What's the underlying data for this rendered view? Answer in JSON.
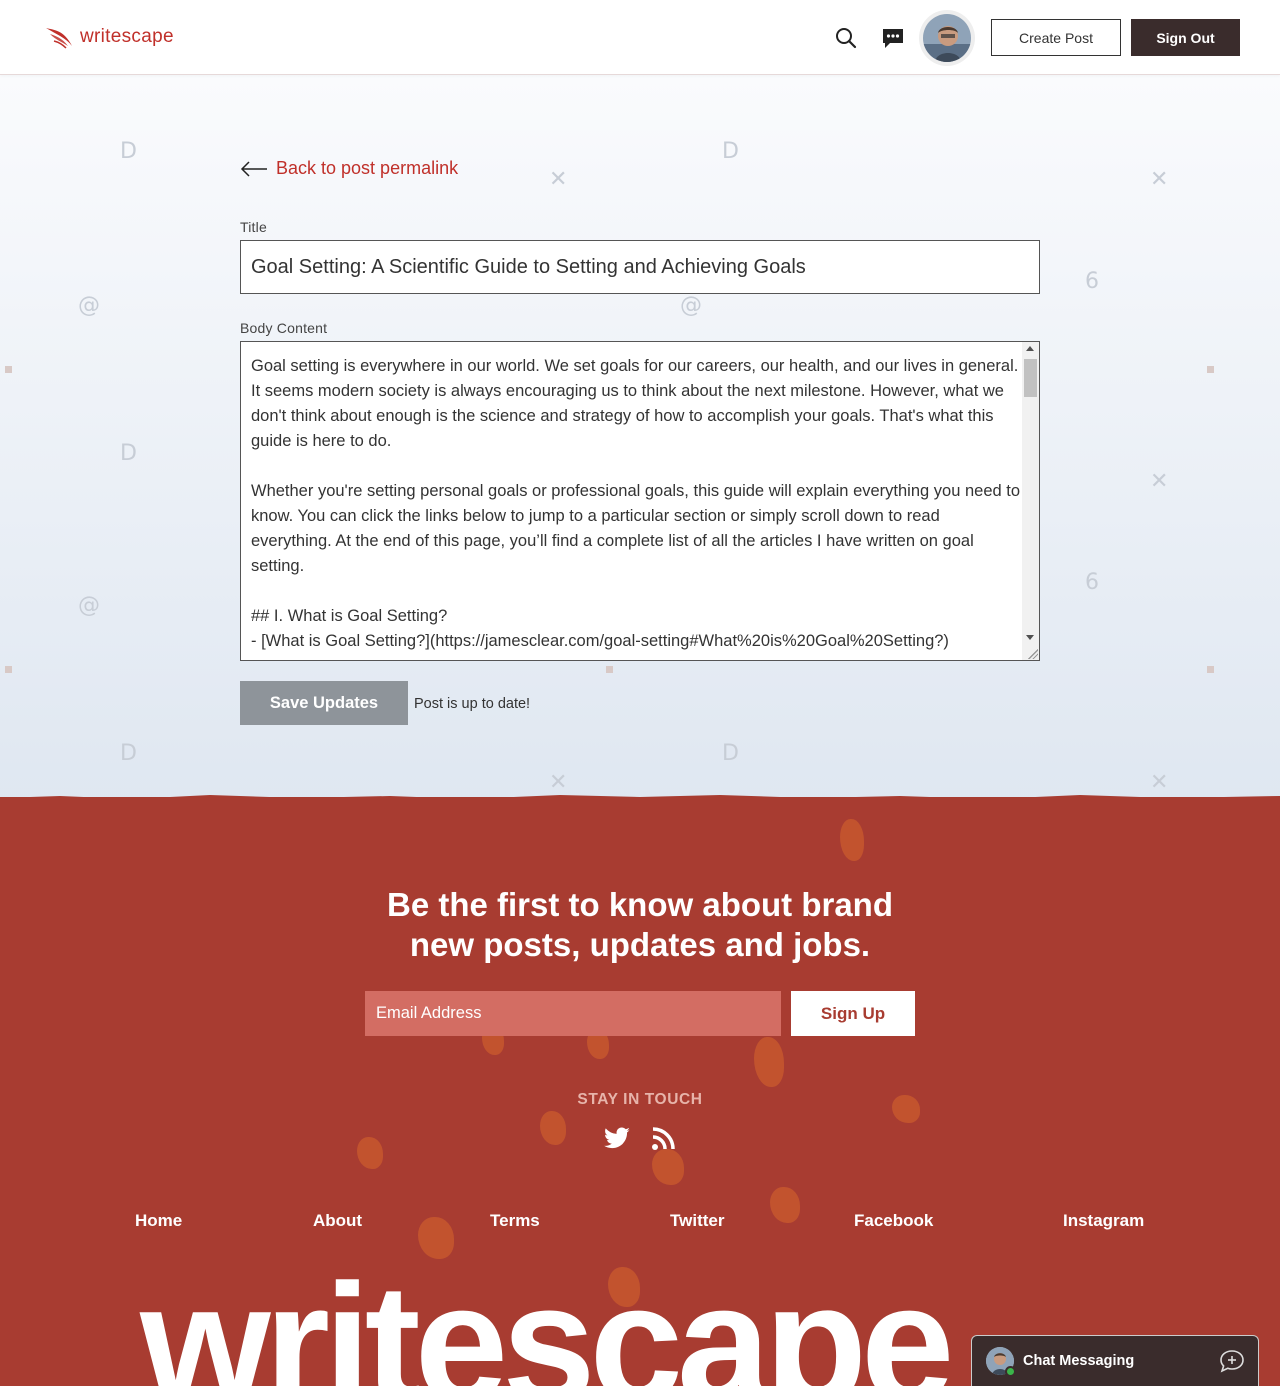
{
  "header": {
    "logo_text": "writescape",
    "create_post_label": "Create Post",
    "sign_out_label": "Sign Out"
  },
  "editor": {
    "back_link_label": "Back to post permalink",
    "title_label": "Title",
    "title_value": "Goal Setting: A Scientific Guide to Setting and Achieving Goals",
    "body_label": "Body Content",
    "body_value": "Goal setting is everywhere in our world. We set goals for our careers, our health, and our lives in general. It seems modern society is always encouraging us to think about the next milestone. However, what we don't think about enough is the science and strategy of how to accomplish your goals. That's what this guide is here to do.\n\nWhether you're setting personal goals or professional goals, this guide will explain everything you need to know. You can click the links below to jump to a particular section or simply scroll down to read everything. At the end of this page, you’ll find a complete list of all the articles I have written on goal setting.\n\n## I. What is Goal Setting?\n- [What is Goal Setting?](https://jamesclear.com/goal-setting#What%20is%20Goal%20Setting?)",
    "save_label": "Save Updates",
    "status_text": "Post is up to date!"
  },
  "footer": {
    "headline_line1": "Be the first to know about brand",
    "headline_line2": "new posts, updates and jobs.",
    "email_placeholder": "Email Address",
    "signup_label": "Sign Up",
    "stay_in_touch": "STAY IN TOUCH",
    "nav": [
      "Home",
      "About",
      "Terms",
      "Twitter",
      "Facebook",
      "Instagram"
    ],
    "big_logo_text": "writescape"
  },
  "chat": {
    "label": "Chat Messaging"
  },
  "colors": {
    "brand_red": "#c0302a",
    "footer_bg": "#a83c31",
    "dark": "#3a2c2c",
    "save_disabled": "#8e949a"
  },
  "icons": {
    "search": "search-icon",
    "messages": "chat-bubble-icon",
    "back": "arrow-left-icon",
    "twitter": "twitter-icon",
    "rss": "rss-icon",
    "new_chat": "new-chat-icon"
  }
}
